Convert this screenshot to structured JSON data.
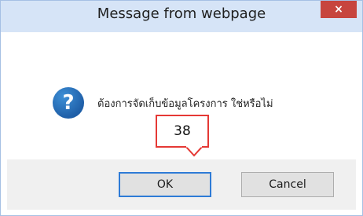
{
  "window": {
    "title": "Message from webpage",
    "close_label": "×"
  },
  "dialog": {
    "icon_glyph": "?",
    "message": "ต้องการจัดเก็บข้อมูลโครงการ ใช่หรือไม่"
  },
  "buttons": {
    "ok_label": "OK",
    "cancel_label": "Cancel"
  },
  "annotation": {
    "number": "38"
  },
  "colors": {
    "titlebar": "#d6e4f7",
    "close_button": "#c7453e",
    "icon_blue": "#1f5fa8",
    "callout_border": "#e53935"
  },
  "icons": {
    "close": "close-icon",
    "question": "question-icon"
  }
}
